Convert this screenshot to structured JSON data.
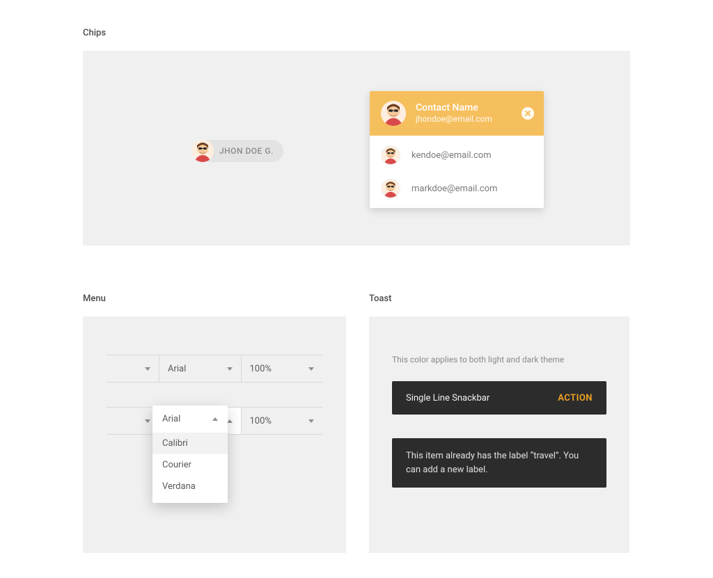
{
  "sections": {
    "chips": {
      "title": "Chips",
      "chip_label": "JHON DOE G.",
      "contact_card": {
        "header_name": "Contact Name",
        "header_email": "jhondoe@email.com",
        "items": [
          {
            "email": "kendoe@email.com"
          },
          {
            "email": "markdoe@email.com"
          }
        ]
      }
    },
    "menu": {
      "title": "Menu",
      "row1_font": "Arial",
      "row1_size": "100%",
      "row2_font": "Arial",
      "row2_size": "100%",
      "popup": {
        "header": "Arial",
        "options": [
          "Calibri",
          "Courier",
          "Verdana"
        ]
      }
    },
    "toast": {
      "title": "Toast",
      "subtitle": "This color applies to both light and dark theme",
      "single_text": "Single Line Snackbar",
      "single_action": "ACTION",
      "multi_text": "This item already has the label “travel”. You can add a new label."
    }
  }
}
